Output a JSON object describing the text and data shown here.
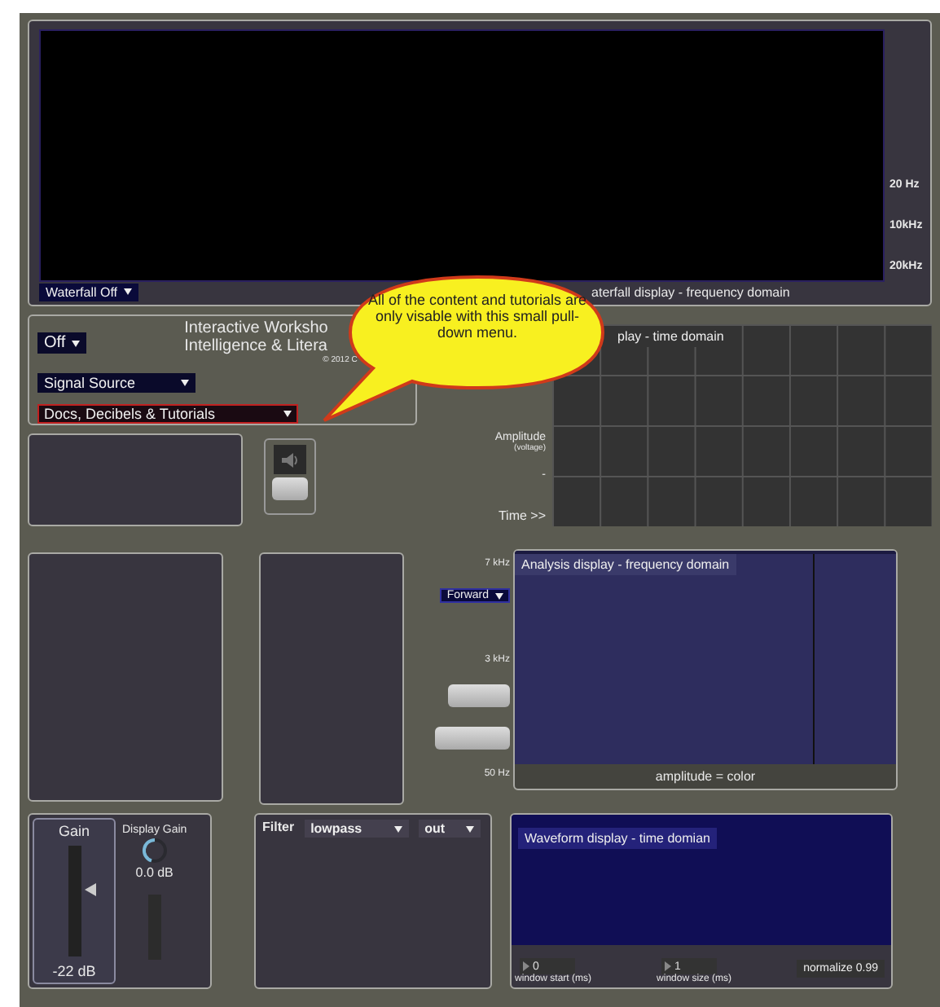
{
  "waterfall": {
    "labels": [
      "20 Hz",
      "10kHz",
      "20kHz"
    ],
    "mode": "Waterfall Off",
    "caption": "aterfall display - frequency domain"
  },
  "control": {
    "power": "Off",
    "title_lines": [
      "Interactive Worksho",
      "Intelligence & Litera"
    ],
    "copyright": "© 2012 C",
    "source": "Signal Source",
    "docs": "Docs, Decibels & Tutorials"
  },
  "callout": "All of the content and tutorials are only visable with this small pull-down menu.",
  "oscilloscope": {
    "caption": "play - time domain",
    "amplitude_label": "Amplitude",
    "amplitude_unit": "(voltage)",
    "minus": "-",
    "time_label": "Time >>"
  },
  "analysis": {
    "freq_labels": [
      "7 kHz",
      "3  kHz",
      "50 Hz"
    ],
    "direction": "Forward",
    "caption": "Analysis display - frequency domain",
    "legend": "amplitude = color"
  },
  "gain": {
    "label": "Gain",
    "level": 0.6,
    "value": "-22 dB"
  },
  "display_gain": {
    "label": "Display Gain",
    "value": "0.0 dB"
  },
  "filter": {
    "label": "Filter",
    "type": "lowpass",
    "routing": "out"
  },
  "waveform": {
    "caption": "Waveform display - time domian",
    "window_start": "0",
    "window_start_label": "window start (ms)",
    "window_size": "1",
    "window_size_label": "window size (ms)",
    "normalize": "normalize 0.99"
  }
}
